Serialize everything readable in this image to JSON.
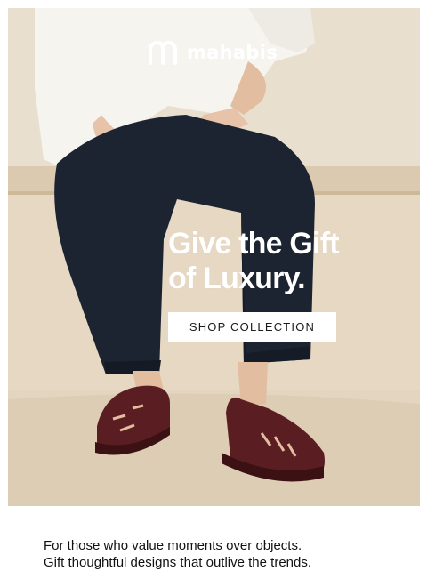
{
  "brand": {
    "name": "mahabis",
    "logo_icon": "mahabis-logo-mark"
  },
  "hero": {
    "headline_line1": "Give the Gift",
    "headline_line2": "of Luxury.",
    "cta_label": "SHOP COLLECTION",
    "image_subject": "person-in-jeans-seated-wearing-burgundy-sandals"
  },
  "body": {
    "line1": "For those who value moments over objects.",
    "line2": "Gift thoughtful designs that outlive the trends."
  },
  "colors": {
    "background_wall": "#e6dbc9",
    "denim": "#1d2431",
    "sandal_burgundy": "#5a1e22",
    "cta_background": "#ffffff",
    "cta_text": "#1a1a1a",
    "text_white": "#ffffff",
    "body_text": "#111111"
  }
}
